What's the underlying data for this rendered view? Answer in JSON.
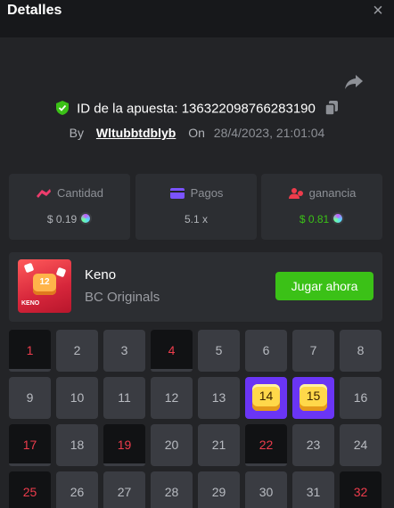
{
  "header": {
    "title": "Detalles",
    "close_label": "×"
  },
  "bet": {
    "id_label": "ID de la apuesta:",
    "id_value": "136322098766283190",
    "by_label": "By",
    "username": "Wltubbtdblyb",
    "on_label": "On",
    "date": "28/4/2023, 21:01:04"
  },
  "stats": [
    {
      "label": "Cantidad",
      "value": "$ 0.19"
    },
    {
      "label": "Pagos",
      "value": "5.1 x"
    },
    {
      "label": "ganancia",
      "value": "$ 0.81"
    }
  ],
  "game": {
    "thumb_number": "12",
    "thumb_label": "KENO",
    "name": "Keno",
    "provider": "BC Originals",
    "play_label": "Jugar ahora"
  },
  "grid": {
    "cells": [
      {
        "n": "1",
        "s": "hit"
      },
      {
        "n": "2",
        "s": ""
      },
      {
        "n": "3",
        "s": ""
      },
      {
        "n": "4",
        "s": "hit"
      },
      {
        "n": "5",
        "s": ""
      },
      {
        "n": "6",
        "s": ""
      },
      {
        "n": "7",
        "s": ""
      },
      {
        "n": "8",
        "s": ""
      },
      {
        "n": "9",
        "s": ""
      },
      {
        "n": "10",
        "s": ""
      },
      {
        "n": "11",
        "s": ""
      },
      {
        "n": "12",
        "s": ""
      },
      {
        "n": "13",
        "s": ""
      },
      {
        "n": "14",
        "s": "win"
      },
      {
        "n": "15",
        "s": "win"
      },
      {
        "n": "16",
        "s": ""
      },
      {
        "n": "17",
        "s": "hit"
      },
      {
        "n": "18",
        "s": ""
      },
      {
        "n": "19",
        "s": "hit"
      },
      {
        "n": "20",
        "s": ""
      },
      {
        "n": "21",
        "s": ""
      },
      {
        "n": "22",
        "s": "hit"
      },
      {
        "n": "23",
        "s": ""
      },
      {
        "n": "24",
        "s": ""
      },
      {
        "n": "25",
        "s": "hit"
      },
      {
        "n": "26",
        "s": ""
      },
      {
        "n": "27",
        "s": ""
      },
      {
        "n": "28",
        "s": ""
      },
      {
        "n": "29",
        "s": ""
      },
      {
        "n": "30",
        "s": ""
      },
      {
        "n": "31",
        "s": ""
      },
      {
        "n": "32",
        "s": "hit"
      }
    ]
  },
  "colors": {
    "accent_green": "#3bc117",
    "hit_red": "#ed3c4c",
    "win_purple": "#6a35f5"
  }
}
